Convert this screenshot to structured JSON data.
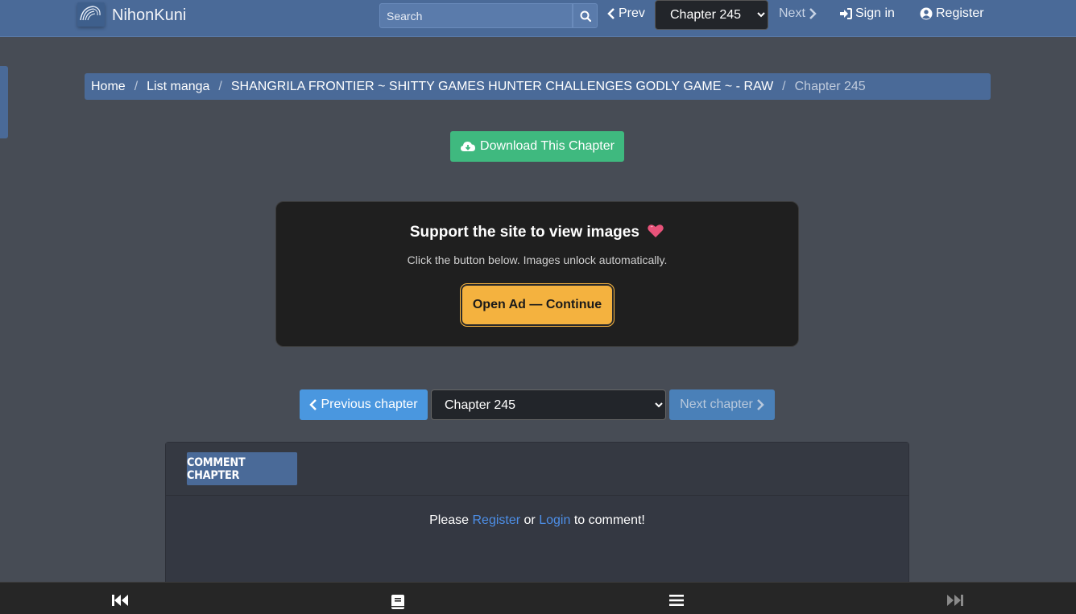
{
  "header": {
    "site_name": "NihonKuni",
    "search_placeholder": "Search",
    "prev_label": "Prev",
    "next_label": "Next",
    "chapter_selected": "Chapter 245",
    "signin_label": "Sign in",
    "register_label": "Register"
  },
  "breadcrumb": {
    "items": [
      "Home",
      "List manga",
      "SHANGRILA FRONTIER ~ SHITTY GAMES HUNTER CHALLENGES GODLY GAME ~ - RAW"
    ],
    "current": "Chapter 245",
    "separator": "/"
  },
  "download": {
    "label": "Download This Chapter"
  },
  "support": {
    "title": "Support the site to view images",
    "subtitle": "Click the button below. Images unlock automatically.",
    "button_label": "Open Ad — Continue"
  },
  "chapter_nav": {
    "prev_label": "Previous chapter",
    "selected": "Chapter 245",
    "next_label": "Next chapter"
  },
  "comments": {
    "tab_label": "COMMENT CHAPTER",
    "msg_prefix": "Please",
    "register_link": "Register",
    "msg_or": "or",
    "login_link": "Login",
    "msg_suffix": "to comment!"
  },
  "bottom_bar": {
    "icons": [
      "first-chapter-icon",
      "book-icon",
      "menu-icon",
      "last-chapter-icon"
    ]
  },
  "colors": {
    "header_bg": "#4a6a98",
    "page_bg": "#474c55",
    "download_green": "#3fb97f",
    "ad_button": "#f4b23f",
    "prev_chapter_blue": "#4a97df",
    "link_blue": "#4d8fe8"
  }
}
